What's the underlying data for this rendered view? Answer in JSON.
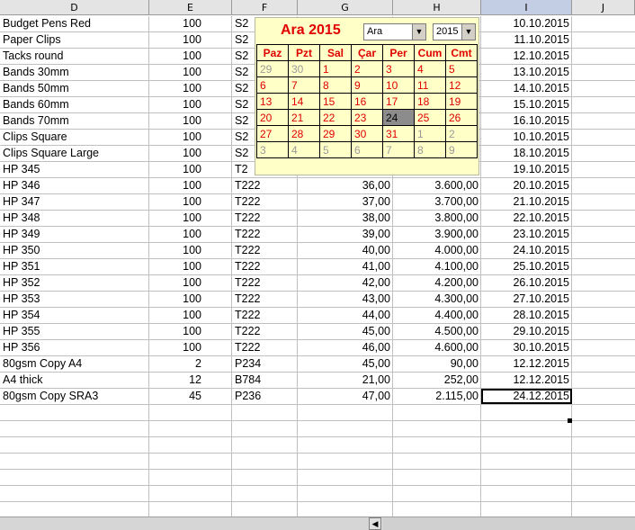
{
  "columns": [
    "D",
    "E",
    "F",
    "G",
    "H",
    "I",
    "J"
  ],
  "selected_column": "I",
  "rows": [
    {
      "d": "Budget Pens Red",
      "e": "100",
      "f": "S2",
      "g": "",
      "h": "",
      "i": "10.10.2015"
    },
    {
      "d": "Paper Clips",
      "e": "100",
      "f": "S2",
      "g": "",
      "h": "",
      "i": "11.10.2015"
    },
    {
      "d": "Tacks round",
      "e": "100",
      "f": "S2",
      "g": "",
      "h": "",
      "i": "12.10.2015"
    },
    {
      "d": "Bands 30mm",
      "e": "100",
      "f": "S2",
      "g": "",
      "h": "",
      "i": "13.10.2015"
    },
    {
      "d": "Bands 50mm",
      "e": "100",
      "f": "S2",
      "g": "",
      "h": "",
      "i": "14.10.2015"
    },
    {
      "d": "Bands 60mm",
      "e": "100",
      "f": "S2",
      "g": "",
      "h": "",
      "i": "15.10.2015"
    },
    {
      "d": "Bands 70mm",
      "e": "100",
      "f": "S2",
      "g": "",
      "h": "",
      "i": "16.10.2015"
    },
    {
      "d": "Clips Square",
      "e": "100",
      "f": "S2",
      "g": "",
      "h": "",
      "i": "10.10.2015"
    },
    {
      "d": "Clips Square Large",
      "e": "100",
      "f": "S2",
      "g": "",
      "h": "",
      "i": "18.10.2015"
    },
    {
      "d": "HP 345",
      "e": "100",
      "f": "T2",
      "g": "",
      "h": "",
      "i": "19.10.2015"
    },
    {
      "d": "HP 346",
      "e": "100",
      "f": "T222",
      "g": "36,00",
      "h": "3.600,00",
      "i": "20.10.2015"
    },
    {
      "d": "HP 347",
      "e": "100",
      "f": "T222",
      "g": "37,00",
      "h": "3.700,00",
      "i": "21.10.2015"
    },
    {
      "d": "HP 348",
      "e": "100",
      "f": "T222",
      "g": "38,00",
      "h": "3.800,00",
      "i": "22.10.2015"
    },
    {
      "d": "HP 349",
      "e": "100",
      "f": "T222",
      "g": "39,00",
      "h": "3.900,00",
      "i": "23.10.2015"
    },
    {
      "d": "HP 350",
      "e": "100",
      "f": "T222",
      "g": "40,00",
      "h": "4.000,00",
      "i": "24.10.2015"
    },
    {
      "d": "HP 351",
      "e": "100",
      "f": "T222",
      "g": "41,00",
      "h": "4.100,00",
      "i": "25.10.2015"
    },
    {
      "d": "HP 352",
      "e": "100",
      "f": "T222",
      "g": "42,00",
      "h": "4.200,00",
      "i": "26.10.2015"
    },
    {
      "d": "HP 353",
      "e": "100",
      "f": "T222",
      "g": "43,00",
      "h": "4.300,00",
      "i": "27.10.2015"
    },
    {
      "d": "HP 354",
      "e": "100",
      "f": "T222",
      "g": "44,00",
      "h": "4.400,00",
      "i": "28.10.2015"
    },
    {
      "d": "HP 355",
      "e": "100",
      "f": "T222",
      "g": "45,00",
      "h": "4.500,00",
      "i": "29.10.2015"
    },
    {
      "d": "HP 356",
      "e": "100",
      "f": "T222",
      "g": "46,00",
      "h": "4.600,00",
      "i": "30.10.2015"
    },
    {
      "d": "80gsm Copy A4",
      "e": "2",
      "f": "P234",
      "g": "45,00",
      "h": "90,00",
      "i": "12.12.2015"
    },
    {
      "d": "A4 thick",
      "e": "12",
      "f": "B784",
      "g": "21,00",
      "h": "252,00",
      "i": "12.12.2015"
    },
    {
      "d": "80gsm Copy SRA3",
      "e": "45",
      "f": "P236",
      "g": "47,00",
      "h": "2.115,00",
      "i": "24.12.2015"
    }
  ],
  "active_cell_row": 23,
  "calendar": {
    "title": "Ara 2015",
    "month_select": "Ara",
    "year_select": "2015",
    "weekdays": [
      "Paz",
      "Pzt",
      "Sal",
      "Çar",
      "Per",
      "Cum",
      "Cmt"
    ],
    "weeks": [
      [
        {
          "t": "29",
          "s": "oth"
        },
        {
          "t": "30",
          "s": "oth"
        },
        {
          "t": "1",
          "s": "cur"
        },
        {
          "t": "2",
          "s": "cur"
        },
        {
          "t": "3",
          "s": "cur"
        },
        {
          "t": "4",
          "s": "cur"
        },
        {
          "t": "5",
          "s": "cur"
        }
      ],
      [
        {
          "t": "6",
          "s": "cur"
        },
        {
          "t": "7",
          "s": "cur"
        },
        {
          "t": "8",
          "s": "cur"
        },
        {
          "t": "9",
          "s": "cur"
        },
        {
          "t": "10",
          "s": "cur"
        },
        {
          "t": "11",
          "s": "cur"
        },
        {
          "t": "12",
          "s": "cur"
        }
      ],
      [
        {
          "t": "13",
          "s": "cur"
        },
        {
          "t": "14",
          "s": "cur"
        },
        {
          "t": "15",
          "s": "cur"
        },
        {
          "t": "16",
          "s": "cur"
        },
        {
          "t": "17",
          "s": "cur"
        },
        {
          "t": "18",
          "s": "cur"
        },
        {
          "t": "19",
          "s": "cur"
        }
      ],
      [
        {
          "t": "20",
          "s": "cur"
        },
        {
          "t": "21",
          "s": "cur"
        },
        {
          "t": "22",
          "s": "cur"
        },
        {
          "t": "23",
          "s": "cur"
        },
        {
          "t": "24",
          "s": "today"
        },
        {
          "t": "25",
          "s": "cur"
        },
        {
          "t": "26",
          "s": "cur"
        }
      ],
      [
        {
          "t": "27",
          "s": "cur"
        },
        {
          "t": "28",
          "s": "cur"
        },
        {
          "t": "29",
          "s": "cur"
        },
        {
          "t": "30",
          "s": "cur"
        },
        {
          "t": "31",
          "s": "cur"
        },
        {
          "t": "1",
          "s": "oth"
        },
        {
          "t": "2",
          "s": "oth"
        }
      ],
      [
        {
          "t": "3",
          "s": "oth"
        },
        {
          "t": "4",
          "s": "oth"
        },
        {
          "t": "5",
          "s": "oth"
        },
        {
          "t": "6",
          "s": "oth"
        },
        {
          "t": "7",
          "s": "oth"
        },
        {
          "t": "8",
          "s": "oth"
        },
        {
          "t": "9",
          "s": "oth"
        }
      ]
    ]
  },
  "icons": {
    "dropdown": "chevron-down-icon",
    "scroll_left": "arrow-left-icon",
    "scroll_stop": "scroll-bar-icon"
  },
  "colors": {
    "accent_red": "#e00000",
    "calendar_bg": "#ffffc8",
    "header_bg": "#e4e4e4",
    "selected_header": "#c3cde3",
    "today_bg": "#8c8c8c"
  }
}
